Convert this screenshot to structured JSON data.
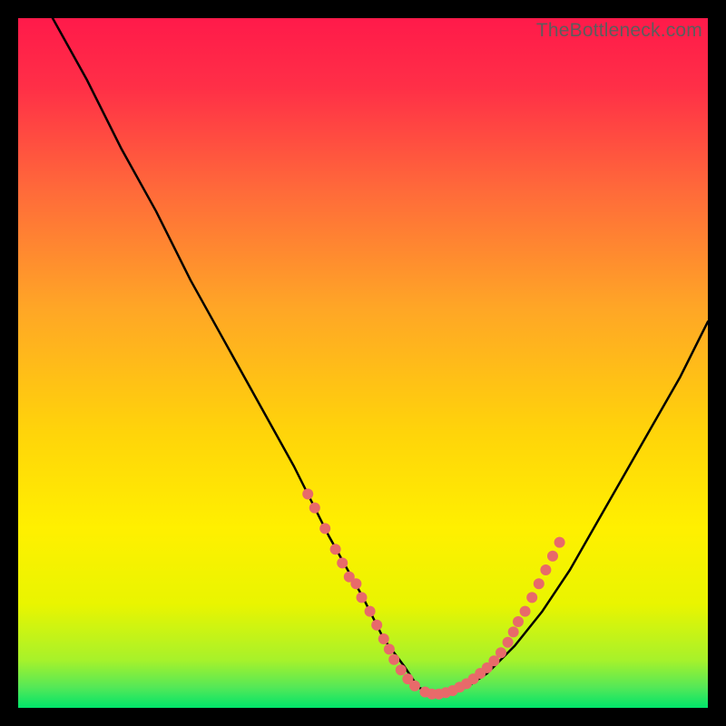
{
  "watermark": "TheBottleneck.com",
  "colors": {
    "background": "#000000",
    "gradient_top": "#ff1a4a",
    "gradient_mid": "#ffd600",
    "gradient_bottom": "#00e56a",
    "curve": "#000000",
    "dots": "#e86a6a",
    "watermark": "#5c5c5c"
  },
  "chart_data": {
    "type": "line",
    "title": "",
    "xlabel": "",
    "ylabel": "",
    "xlim": [
      0,
      100
    ],
    "ylim": [
      0,
      100
    ],
    "series": [
      {
        "name": "bottleneck-curve",
        "x": [
          5,
          10,
          15,
          20,
          25,
          30,
          35,
          40,
          45,
          50,
          53,
          56,
          58,
          60,
          62,
          65,
          68,
          72,
          76,
          80,
          84,
          88,
          92,
          96,
          100
        ],
        "y": [
          100,
          91,
          81,
          72,
          62,
          53,
          44,
          35,
          25,
          16,
          10,
          6,
          3,
          2,
          2,
          3,
          5,
          9,
          14,
          20,
          27,
          34,
          41,
          48,
          56
        ]
      }
    ],
    "highlight_points": [
      {
        "x": 42,
        "y": 31
      },
      {
        "x": 43,
        "y": 29
      },
      {
        "x": 44.5,
        "y": 26
      },
      {
        "x": 46,
        "y": 23
      },
      {
        "x": 47,
        "y": 21
      },
      {
        "x": 48,
        "y": 19
      },
      {
        "x": 49,
        "y": 18
      },
      {
        "x": 49.8,
        "y": 16
      },
      {
        "x": 51,
        "y": 14
      },
      {
        "x": 52,
        "y": 12
      },
      {
        "x": 53,
        "y": 10
      },
      {
        "x": 53.8,
        "y": 8.5
      },
      {
        "x": 54.5,
        "y": 7
      },
      {
        "x": 55.5,
        "y": 5.5
      },
      {
        "x": 56.5,
        "y": 4.2
      },
      {
        "x": 57.5,
        "y": 3.2
      },
      {
        "x": 59,
        "y": 2.3
      },
      {
        "x": 60,
        "y": 2
      },
      {
        "x": 61,
        "y": 2
      },
      {
        "x": 62,
        "y": 2.2
      },
      {
        "x": 63,
        "y": 2.5
      },
      {
        "x": 64,
        "y": 3
      },
      {
        "x": 65,
        "y": 3.5
      },
      {
        "x": 66,
        "y": 4.2
      },
      {
        "x": 67,
        "y": 5
      },
      {
        "x": 68,
        "y": 5.8
      },
      {
        "x": 69,
        "y": 6.8
      },
      {
        "x": 70,
        "y": 8
      },
      {
        "x": 71,
        "y": 9.5
      },
      {
        "x": 71.8,
        "y": 11
      },
      {
        "x": 72.5,
        "y": 12.5
      },
      {
        "x": 73.5,
        "y": 14
      },
      {
        "x": 74.5,
        "y": 16
      },
      {
        "x": 75.5,
        "y": 18
      },
      {
        "x": 76.5,
        "y": 20
      },
      {
        "x": 77.5,
        "y": 22
      },
      {
        "x": 78.5,
        "y": 24
      }
    ],
    "yellow_band": {
      "ymin": 13,
      "ymax": 32
    },
    "green_band": {
      "ymin": 0,
      "ymax": 3
    }
  }
}
